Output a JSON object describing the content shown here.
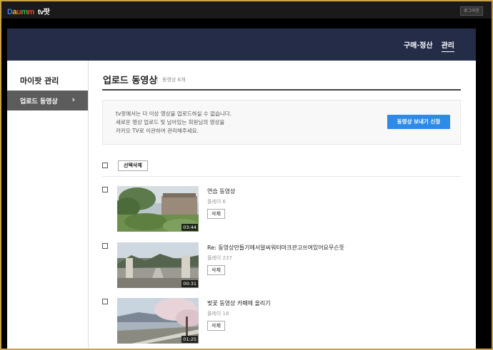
{
  "topbar": {
    "logo": [
      "D",
      "a",
      "u",
      "m",
      "m"
    ],
    "service": "tv팟",
    "login_label": "로그아웃"
  },
  "header": {
    "nav": [
      {
        "label": "구매·정산",
        "active": false
      },
      {
        "label": "관리",
        "active": true
      }
    ]
  },
  "sidebar": {
    "title": "마이팟 관리",
    "items": [
      {
        "label": "업로드 동영상",
        "selected": true
      }
    ]
  },
  "main": {
    "title": "업로드 동영상",
    "count": "동영상 6개",
    "notice": {
      "lines": [
        "tv팟에서는 더 이상 영상을 업로드하실 수 없습니다.",
        "새로운 영상 업로드 및 남아있는 회원님의 영상을",
        "카카오 TV로 이관하여 관리해주세요."
      ],
      "button_label": "동영상 보내기 신청"
    },
    "toolbar": {
      "delete_selected_label": "선택삭제"
    },
    "videos": [
      {
        "title": "연습 동영상",
        "plays": "플레이 6",
        "duration": "03:44",
        "delete_label": "삭제"
      },
      {
        "title": "Re: 동영상만들기에서알씨워터마크관고쓰여있어요무슨뜻",
        "plays": "플레이 237",
        "duration": "00:31",
        "delete_label": "삭제"
      },
      {
        "title": "벚꽃 동영상 카페에 올리기",
        "plays": "플레이 18",
        "duration": "01:25",
        "delete_label": "삭제"
      }
    ]
  },
  "colors": {
    "header_bg": "#252c48",
    "accent_button": "#2d8ae6",
    "sidebar_selected": "#5c5c5c",
    "frame_border": "#c9a24a"
  }
}
